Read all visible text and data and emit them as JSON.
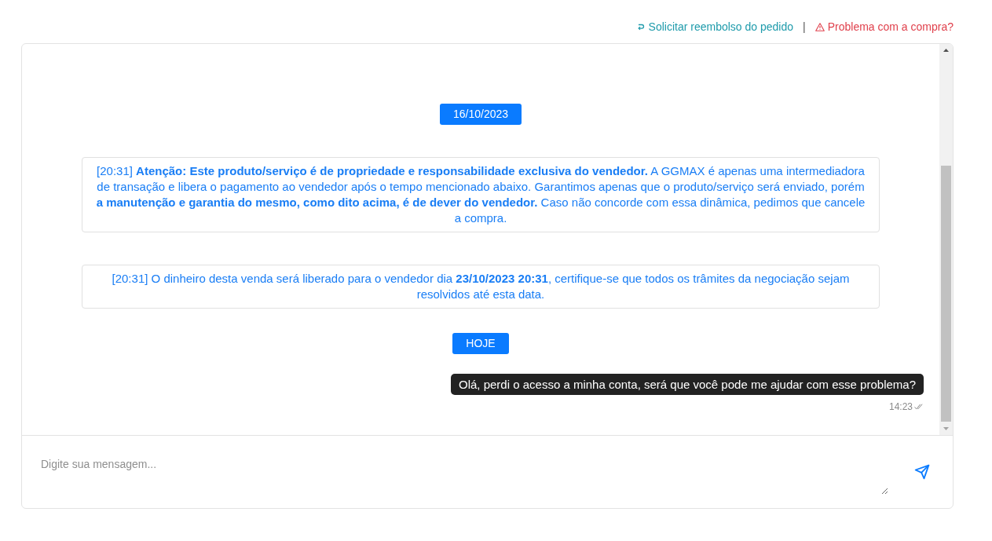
{
  "header_links": [
    {
      "kind": "refund",
      "label": "Solicitar reembolso do pedido"
    },
    {
      "kind": "separator",
      "label": "|"
    },
    {
      "kind": "problem",
      "label": "Problema com a compra?"
    }
  ],
  "messages": [
    {
      "kind": "date",
      "text": "16/10/2023"
    },
    {
      "kind": "system",
      "text": "[20:31] **Atenção: Este produto/serviço é de propriedade e responsabilidade exclusiva do vendedor.** A GGMAX é apenas uma intermediadora de transação e libera o pagamento ao vendedor após o tempo mencionado abaixo. Garantimos apenas que o produto/serviço será enviado, porém **a manutenção e garantia do mesmo, como dito acima, é de dever do vendedor.** Caso não concorde com essa dinâmica, pedimos que cancele a compra."
    },
    {
      "kind": "system",
      "text": "[20:31] O dinheiro desta venda será liberado para o vendedor dia **23/10/2023 20:31**, certifique-se que todos os trâmites da negociação sejam resolvidos até esta data."
    },
    {
      "kind": "date",
      "text": "HOJE"
    },
    {
      "kind": "outgoing",
      "text": "Olá, perdi o acesso a minha conta, será que você pode me ajudar com esse problema?",
      "time": "14:23"
    }
  ],
  "composer": {
    "placeholder": "Digite sua mensagem..."
  }
}
